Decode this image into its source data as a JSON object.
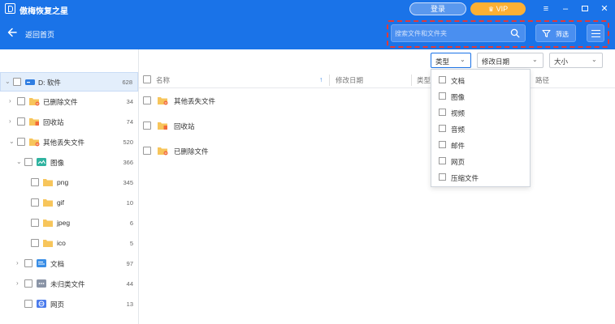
{
  "app": {
    "title": "傲梅恢复之星",
    "login_label": "登录",
    "vip_label": "VIP",
    "accent_color": "#1a73e8"
  },
  "toolbar": {
    "back_label": "返回首页",
    "search_placeholder": "搜索文件和文件夹",
    "filter_label": "筛选"
  },
  "sidebar": {
    "items": [
      {
        "label": "D: 软件",
        "count": "628",
        "icon": "drive-icon"
      },
      {
        "label": "已删除文件",
        "count": "34",
        "icon": "deleted-folder-icon"
      },
      {
        "label": "回收站",
        "count": "74",
        "icon": "recycle-bin-icon"
      },
      {
        "label": "其他丢失文件",
        "count": "520",
        "icon": "lost-folder-icon"
      },
      {
        "label": "图像",
        "count": "366",
        "icon": "image-category-icon"
      },
      {
        "label": "png",
        "count": "345",
        "icon": "folder-icon"
      },
      {
        "label": "gif",
        "count": "10",
        "icon": "folder-icon"
      },
      {
        "label": "jpeg",
        "count": "6",
        "icon": "folder-icon"
      },
      {
        "label": "ico",
        "count": "5",
        "icon": "folder-icon"
      },
      {
        "label": "文档",
        "count": "97",
        "icon": "document-category-icon"
      },
      {
        "label": "未归类文件",
        "count": "44",
        "icon": "unclassified-category-icon"
      },
      {
        "label": "网页",
        "count": "13",
        "icon": "webpage-category-icon"
      }
    ]
  },
  "filters": {
    "type_label": "类型",
    "date_label": "修改日期",
    "size_label": "大小"
  },
  "table": {
    "columns": {
      "name": "名称",
      "modified": "修改日期",
      "type": "类型",
      "path": "路径"
    },
    "rows": [
      {
        "name": "其他丢失文件",
        "icon": "lost-folder-icon"
      },
      {
        "name": "回收站",
        "icon": "recycle-bin-icon"
      },
      {
        "name": "已删除文件",
        "icon": "deleted-folder-icon"
      }
    ]
  },
  "type_dropdown": {
    "options": [
      "文档",
      "图像",
      "视频",
      "音频",
      "邮件",
      "网页",
      "压缩文件"
    ]
  }
}
